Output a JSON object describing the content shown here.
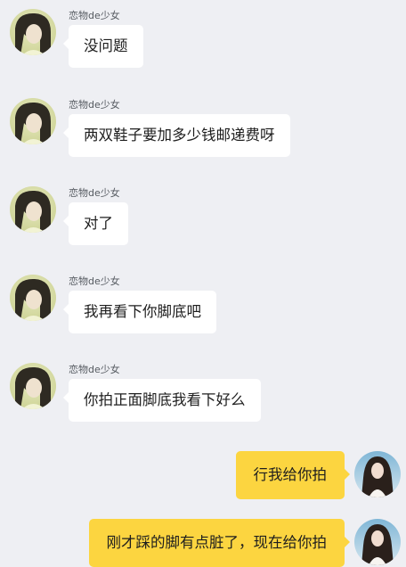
{
  "messages": [
    {
      "sender": "恋物de少女",
      "text": "没问题",
      "side": "left"
    },
    {
      "sender": "恋物de少女",
      "text": "两双鞋子要加多少钱邮递费呀",
      "side": "left"
    },
    {
      "sender": "恋物de少女",
      "text": "对了",
      "side": "left"
    },
    {
      "sender": "恋物de少女",
      "text": "我再看下你脚底吧",
      "side": "left"
    },
    {
      "sender": "恋物de少女",
      "text": "你拍正面脚底我看下好么",
      "side": "left"
    },
    {
      "text": "行我给你拍",
      "side": "right"
    },
    {
      "text": "刚才踩的脚有点脏了，现在给你拍",
      "side": "right"
    }
  ],
  "colors": {
    "background": "#eeeff3",
    "incoming_bubble": "#ffffff",
    "outgoing_bubble": "#fcd540",
    "sender_name": "#555a60"
  }
}
